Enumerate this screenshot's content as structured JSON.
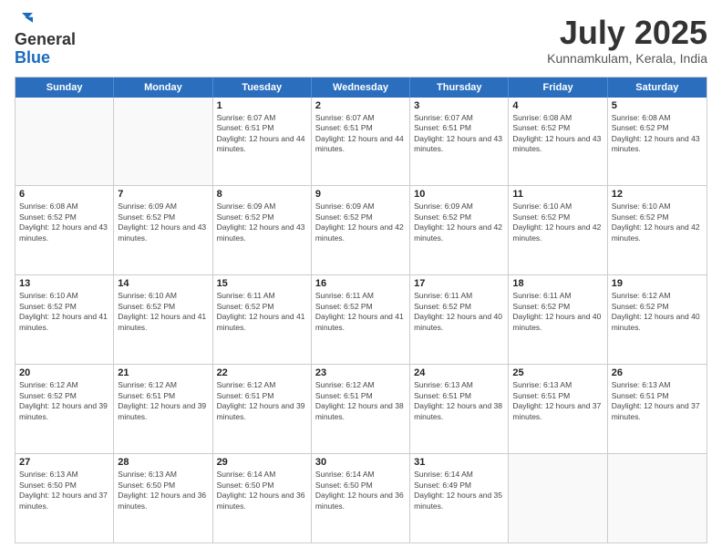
{
  "logo": {
    "general": "General",
    "blue": "Blue"
  },
  "header": {
    "title": "July 2025",
    "subtitle": "Kunnamkulam, Kerala, India"
  },
  "days": [
    "Sunday",
    "Monday",
    "Tuesday",
    "Wednesday",
    "Thursday",
    "Friday",
    "Saturday"
  ],
  "weeks": [
    [
      {
        "day": "",
        "sunrise": "",
        "sunset": "",
        "daylight": ""
      },
      {
        "day": "",
        "sunrise": "",
        "sunset": "",
        "daylight": ""
      },
      {
        "day": "1",
        "sunrise": "Sunrise: 6:07 AM",
        "sunset": "Sunset: 6:51 PM",
        "daylight": "Daylight: 12 hours and 44 minutes."
      },
      {
        "day": "2",
        "sunrise": "Sunrise: 6:07 AM",
        "sunset": "Sunset: 6:51 PM",
        "daylight": "Daylight: 12 hours and 44 minutes."
      },
      {
        "day": "3",
        "sunrise": "Sunrise: 6:07 AM",
        "sunset": "Sunset: 6:51 PM",
        "daylight": "Daylight: 12 hours and 43 minutes."
      },
      {
        "day": "4",
        "sunrise": "Sunrise: 6:08 AM",
        "sunset": "Sunset: 6:52 PM",
        "daylight": "Daylight: 12 hours and 43 minutes."
      },
      {
        "day": "5",
        "sunrise": "Sunrise: 6:08 AM",
        "sunset": "Sunset: 6:52 PM",
        "daylight": "Daylight: 12 hours and 43 minutes."
      }
    ],
    [
      {
        "day": "6",
        "sunrise": "Sunrise: 6:08 AM",
        "sunset": "Sunset: 6:52 PM",
        "daylight": "Daylight: 12 hours and 43 minutes."
      },
      {
        "day": "7",
        "sunrise": "Sunrise: 6:09 AM",
        "sunset": "Sunset: 6:52 PM",
        "daylight": "Daylight: 12 hours and 43 minutes."
      },
      {
        "day": "8",
        "sunrise": "Sunrise: 6:09 AM",
        "sunset": "Sunset: 6:52 PM",
        "daylight": "Daylight: 12 hours and 43 minutes."
      },
      {
        "day": "9",
        "sunrise": "Sunrise: 6:09 AM",
        "sunset": "Sunset: 6:52 PM",
        "daylight": "Daylight: 12 hours and 42 minutes."
      },
      {
        "day": "10",
        "sunrise": "Sunrise: 6:09 AM",
        "sunset": "Sunset: 6:52 PM",
        "daylight": "Daylight: 12 hours and 42 minutes."
      },
      {
        "day": "11",
        "sunrise": "Sunrise: 6:10 AM",
        "sunset": "Sunset: 6:52 PM",
        "daylight": "Daylight: 12 hours and 42 minutes."
      },
      {
        "day": "12",
        "sunrise": "Sunrise: 6:10 AM",
        "sunset": "Sunset: 6:52 PM",
        "daylight": "Daylight: 12 hours and 42 minutes."
      }
    ],
    [
      {
        "day": "13",
        "sunrise": "Sunrise: 6:10 AM",
        "sunset": "Sunset: 6:52 PM",
        "daylight": "Daylight: 12 hours and 41 minutes."
      },
      {
        "day": "14",
        "sunrise": "Sunrise: 6:10 AM",
        "sunset": "Sunset: 6:52 PM",
        "daylight": "Daylight: 12 hours and 41 minutes."
      },
      {
        "day": "15",
        "sunrise": "Sunrise: 6:11 AM",
        "sunset": "Sunset: 6:52 PM",
        "daylight": "Daylight: 12 hours and 41 minutes."
      },
      {
        "day": "16",
        "sunrise": "Sunrise: 6:11 AM",
        "sunset": "Sunset: 6:52 PM",
        "daylight": "Daylight: 12 hours and 41 minutes."
      },
      {
        "day": "17",
        "sunrise": "Sunrise: 6:11 AM",
        "sunset": "Sunset: 6:52 PM",
        "daylight": "Daylight: 12 hours and 40 minutes."
      },
      {
        "day": "18",
        "sunrise": "Sunrise: 6:11 AM",
        "sunset": "Sunset: 6:52 PM",
        "daylight": "Daylight: 12 hours and 40 minutes."
      },
      {
        "day": "19",
        "sunrise": "Sunrise: 6:12 AM",
        "sunset": "Sunset: 6:52 PM",
        "daylight": "Daylight: 12 hours and 40 minutes."
      }
    ],
    [
      {
        "day": "20",
        "sunrise": "Sunrise: 6:12 AM",
        "sunset": "Sunset: 6:52 PM",
        "daylight": "Daylight: 12 hours and 39 minutes."
      },
      {
        "day": "21",
        "sunrise": "Sunrise: 6:12 AM",
        "sunset": "Sunset: 6:51 PM",
        "daylight": "Daylight: 12 hours and 39 minutes."
      },
      {
        "day": "22",
        "sunrise": "Sunrise: 6:12 AM",
        "sunset": "Sunset: 6:51 PM",
        "daylight": "Daylight: 12 hours and 39 minutes."
      },
      {
        "day": "23",
        "sunrise": "Sunrise: 6:12 AM",
        "sunset": "Sunset: 6:51 PM",
        "daylight": "Daylight: 12 hours and 38 minutes."
      },
      {
        "day": "24",
        "sunrise": "Sunrise: 6:13 AM",
        "sunset": "Sunset: 6:51 PM",
        "daylight": "Daylight: 12 hours and 38 minutes."
      },
      {
        "day": "25",
        "sunrise": "Sunrise: 6:13 AM",
        "sunset": "Sunset: 6:51 PM",
        "daylight": "Daylight: 12 hours and 37 minutes."
      },
      {
        "day": "26",
        "sunrise": "Sunrise: 6:13 AM",
        "sunset": "Sunset: 6:51 PM",
        "daylight": "Daylight: 12 hours and 37 minutes."
      }
    ],
    [
      {
        "day": "27",
        "sunrise": "Sunrise: 6:13 AM",
        "sunset": "Sunset: 6:50 PM",
        "daylight": "Daylight: 12 hours and 37 minutes."
      },
      {
        "day": "28",
        "sunrise": "Sunrise: 6:13 AM",
        "sunset": "Sunset: 6:50 PM",
        "daylight": "Daylight: 12 hours and 36 minutes."
      },
      {
        "day": "29",
        "sunrise": "Sunrise: 6:14 AM",
        "sunset": "Sunset: 6:50 PM",
        "daylight": "Daylight: 12 hours and 36 minutes."
      },
      {
        "day": "30",
        "sunrise": "Sunrise: 6:14 AM",
        "sunset": "Sunset: 6:50 PM",
        "daylight": "Daylight: 12 hours and 36 minutes."
      },
      {
        "day": "31",
        "sunrise": "Sunrise: 6:14 AM",
        "sunset": "Sunset: 6:49 PM",
        "daylight": "Daylight: 12 hours and 35 minutes."
      },
      {
        "day": "",
        "sunrise": "",
        "sunset": "",
        "daylight": ""
      },
      {
        "day": "",
        "sunrise": "",
        "sunset": "",
        "daylight": ""
      }
    ]
  ]
}
